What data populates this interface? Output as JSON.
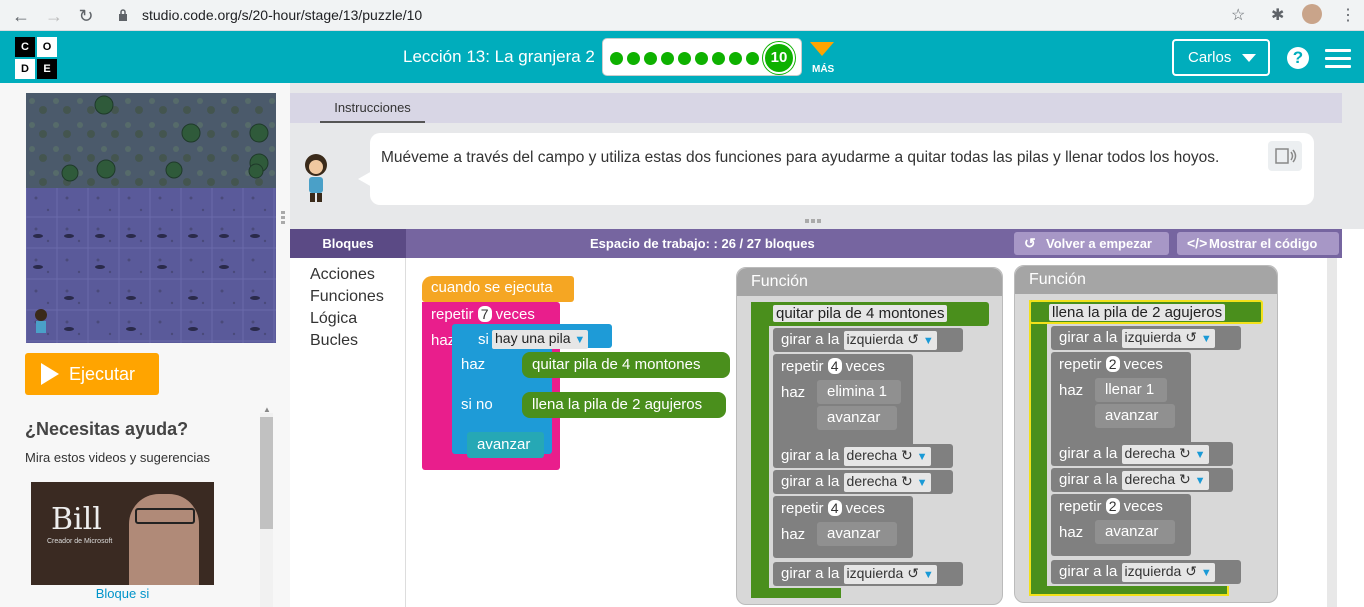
{
  "browser": {
    "url": "studio.code.org/s/20-hour/stage/13/puzzle/10"
  },
  "header": {
    "logo_letters": [
      "C",
      "O",
      "D",
      "E"
    ],
    "lesson_title": "Lección 13: La granjera 2",
    "progress_current": "10",
    "progress_done_count": 9,
    "more_label": "MÁS",
    "user_name": "Carlos",
    "help_label": "?",
    "brand_color": "#00adbc"
  },
  "left": {
    "run_label": "Ejecutar",
    "help_title": "¿Necesitas ayuda?",
    "help_subtitle": "Mira estos videos y sugerencias",
    "video_overlay": "Bill",
    "video_overlay_sub": "Creador de Microsoft",
    "video_caption": "Bloque si"
  },
  "instructions": {
    "tab_label": "Instrucciones",
    "text": "Muéveme a través del campo y utiliza estas dos funciones para ayudarme a quitar todas las pilas y llenar todos los hoyos."
  },
  "workspace": {
    "toolbox_title": "Bloques",
    "title": "Espacio de trabajo: : 26 / 27 bloques",
    "reset_label": "Volver a empezar",
    "show_code_label": "Mostrar el código",
    "categories": [
      "Acciones",
      "Funciones",
      "Lógica",
      "Bucles"
    ],
    "main": {
      "when_run": "cuando se ejecuta",
      "repeat_prefix": "repetir",
      "repeat_count": "7",
      "repeat_suffix": "veces",
      "do_label": "haz",
      "if_label": "si",
      "if_condition": "hay una pila",
      "then_label": "haz",
      "then_call": "quitar pila de 4 montones",
      "else_label": "si no",
      "else_call": "llena la pila de 2 agujeros",
      "forward": "avanzar"
    },
    "func1": {
      "panel_title": "Función",
      "name": "quitar pila de 4 montones",
      "turn_prefix": "girar a la",
      "left": "izquierda ↺",
      "right": "derecha ↻",
      "repeat_prefix": "repetir",
      "repeat_count": "4",
      "repeat_suffix": "veces",
      "do_label": "haz",
      "remove_one": "elimina 1",
      "forward": "avanzar"
    },
    "func2": {
      "panel_title": "Función",
      "name": "llena la pila de 2 agujeros",
      "turn_prefix": "girar a la",
      "left": "izquierda ↺",
      "right": "derecha ↻",
      "repeat_prefix": "repetir",
      "repeat_count": "2",
      "repeat_suffix": "veces",
      "do_label": "haz",
      "fill_one": "llenar 1",
      "forward": "avanzar"
    }
  }
}
